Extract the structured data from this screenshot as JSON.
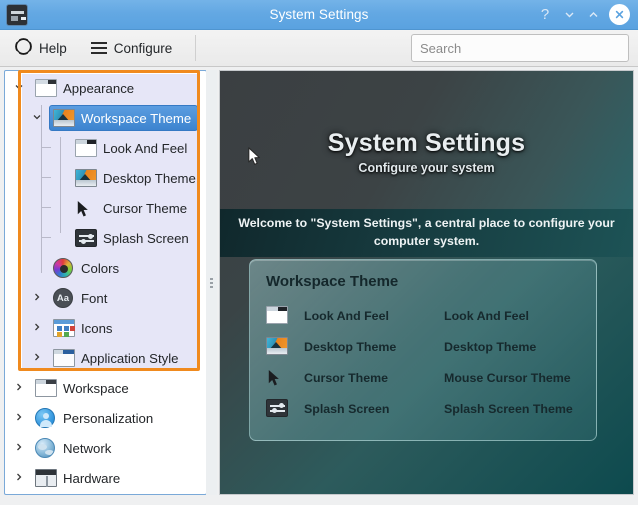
{
  "window": {
    "title": "System Settings",
    "app_icon": "system-settings-icon",
    "buttons": {
      "help": "?",
      "minimize": "minimize-icon",
      "maximize": "maximize-icon",
      "close": "close-icon"
    }
  },
  "toolbar": {
    "help_label": "Help",
    "configure_label": "Configure",
    "search_placeholder": "Search",
    "search_value": ""
  },
  "sidebar": {
    "items": [
      {
        "label": "Appearance",
        "level": 0,
        "icon": "window-icon",
        "expander": "expanded",
        "selected": false
      },
      {
        "label": "Workspace Theme",
        "level": 1,
        "icon": "desktop-theme-icon",
        "expander": "expanded",
        "selected": true
      },
      {
        "label": "Look And Feel",
        "level": 2,
        "icon": "look-and-feel-icon",
        "expander": "none",
        "selected": false
      },
      {
        "label": "Desktop Theme",
        "level": 2,
        "icon": "desktop-theme-icon",
        "expander": "none",
        "selected": false
      },
      {
        "label": "Cursor Theme",
        "level": 2,
        "icon": "cursor-icon",
        "expander": "none",
        "selected": false
      },
      {
        "label": "Splash Screen",
        "level": 2,
        "icon": "splash-screen-icon",
        "expander": "none",
        "selected": false
      },
      {
        "label": "Colors",
        "level": 1,
        "icon": "color-wheel-icon",
        "expander": "none",
        "selected": false
      },
      {
        "label": "Font",
        "level": 1,
        "icon": "font-icon",
        "expander": "collapsed",
        "selected": false
      },
      {
        "label": "Icons",
        "level": 1,
        "icon": "icons-icon",
        "expander": "collapsed",
        "selected": false
      },
      {
        "label": "Application Style",
        "level": 1,
        "icon": "application-style-icon",
        "expander": "collapsed",
        "selected": false
      },
      {
        "label": "Workspace",
        "level": 0,
        "icon": "workspace-icon",
        "expander": "collapsed",
        "selected": false
      },
      {
        "label": "Personalization",
        "level": 0,
        "icon": "person-icon",
        "expander": "collapsed",
        "selected": false
      },
      {
        "label": "Network",
        "level": 0,
        "icon": "globe-icon",
        "expander": "collapsed",
        "selected": false
      },
      {
        "label": "Hardware",
        "level": 0,
        "icon": "hardware-icon",
        "expander": "collapsed",
        "selected": false
      }
    ],
    "highlight_color": "#f08a1e"
  },
  "main": {
    "hero_title": "System Settings",
    "hero_subtitle": "Configure your system",
    "welcome_text": "Welcome to \"System Settings\", a central place to configure your computer system.",
    "card": {
      "title": "Workspace Theme",
      "rows": [
        {
          "icon": "look-and-feel-icon",
          "name": "Look And Feel",
          "description": "Look And Feel"
        },
        {
          "icon": "desktop-theme-icon",
          "name": "Desktop Theme",
          "description": "Desktop Theme"
        },
        {
          "icon": "cursor-icon",
          "name": "Cursor Theme",
          "description": "Mouse Cursor Theme"
        },
        {
          "icon": "splash-screen-icon",
          "name": "Splash Screen",
          "description": "Splash Screen Theme"
        }
      ]
    }
  },
  "colors": {
    "titlebar": "#63a8e3",
    "accent": "#3d84cf",
    "highlight": "#f08a1e",
    "panel_dark": "#3b3f42",
    "panel_teal": "#0d4a4e"
  }
}
